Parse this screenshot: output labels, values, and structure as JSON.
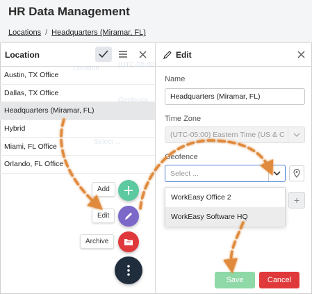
{
  "app": {
    "title": "HR Data Management"
  },
  "breadcrumb": {
    "root": "Locations",
    "separator": "/",
    "current": "Headquarters (Miramar, FL)"
  },
  "location_panel": {
    "title": "Location",
    "items": [
      "Austin, TX Office",
      "Dallas, TX Office",
      "Headquarters (Miramar, FL)",
      "Hybrid",
      "Miami, FL Office",
      "Orlando, FL Office"
    ],
    "selected_index": 2
  },
  "fab_menu": {
    "add_label": "Add",
    "edit_label": "Edit",
    "archive_label": "Archive",
    "add_color": "#5cc9a0",
    "edit_color": "#7b68c8",
    "archive_color": "#e0393b"
  },
  "edit_panel": {
    "title": "Edit",
    "name_label": "Name",
    "name_value": "Headquarters (Miramar, FL)",
    "timezone_label": "Time Zone",
    "timezone_value": "(UTC-05:00) Eastern Time (US & C",
    "geofence_label": "Geofence",
    "geofence_placeholder": "Select ...",
    "geofence_options": [
      "WorkEasy Office 2",
      "WorkEasy Software HQ"
    ],
    "save_label": "Save",
    "cancel_label": "Cancel"
  },
  "colors": {
    "accent_arrow": "#e08a3c",
    "save": "#8fd8a7",
    "cancel": "#e0393b",
    "select_border": "#4a7fd6"
  },
  "ghost_text": [
    "(UTC-05:00)",
    "Location",
    "Geofence",
    "Select ..."
  ]
}
